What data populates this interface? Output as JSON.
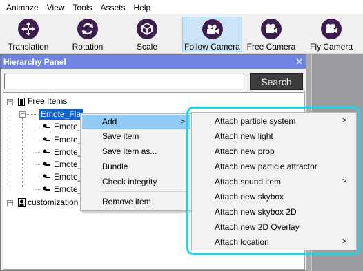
{
  "menubar": {
    "items": [
      "Animaze",
      "View",
      "Tools",
      "Assets",
      "Help"
    ]
  },
  "toolbar": {
    "buttons": [
      {
        "label": "Translation",
        "icon": "translation-arrows-icon"
      },
      {
        "label": "Rotation",
        "icon": "rotation-icon"
      },
      {
        "label": "Scale",
        "icon": "scale-icon"
      },
      {
        "label": "Follow Camera",
        "icon": "camera-icon",
        "active": true
      },
      {
        "label": "Free Camera",
        "icon": "camera-icon"
      },
      {
        "label": "Fly Camera",
        "icon": "camera-icon"
      }
    ],
    "icon_color": "#3b1e4e",
    "active_bg": "#cce4f7"
  },
  "panel": {
    "title": "Hierarchy Panel",
    "close_glyph": "✕",
    "title_bg": "#6e84e0",
    "search": {
      "value": "",
      "placeholder": "",
      "button_label": "Search"
    }
  },
  "tree": {
    "root_free_items": "Free Items",
    "selected": "Emote_Fla",
    "children": [
      "Emote_",
      "Emote_",
      "Emote_",
      "Emote_",
      "Emote_",
      "Emote_"
    ],
    "root_customization": "customization",
    "selection_color": "#0a64d6"
  },
  "context_menu": {
    "items": [
      "Add",
      "Save item",
      "Save item as...",
      "Bundle",
      "Check integrity",
      "Remove item"
    ],
    "arrow_glyph": ">",
    "highlight_color": "#91c9f7"
  },
  "submenu": {
    "items": [
      {
        "label": "Attach particle system",
        "has_submenu": true
      },
      {
        "label": "Attach new light",
        "has_submenu": false
      },
      {
        "label": "Attach new prop",
        "has_submenu": false
      },
      {
        "label": "Attach new particle attractor",
        "has_submenu": false
      },
      {
        "label": "Attach sound item",
        "has_submenu": true
      },
      {
        "label": "Attach new skybox",
        "has_submenu": false
      },
      {
        "label": "Attach new skybox 2D",
        "has_submenu": false
      },
      {
        "label": "Attach new 2D Overlay",
        "has_submenu": false
      },
      {
        "label": "Attach location",
        "has_submenu": true
      }
    ],
    "outline_color": "#1ad6e8"
  }
}
